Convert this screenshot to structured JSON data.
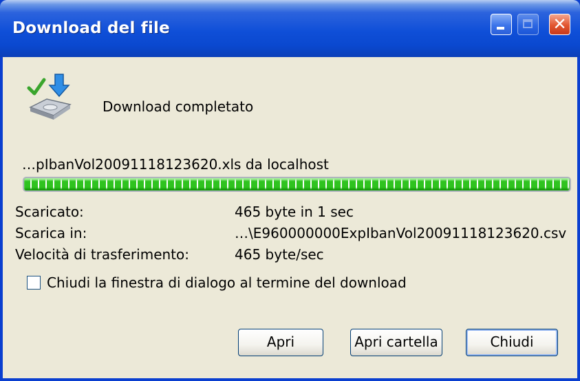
{
  "window": {
    "title": "Download del file"
  },
  "titlebar_buttons": {
    "minimize_icon": "minimize-icon",
    "maximize_icon": "maximize-icon",
    "close_icon": "close-icon",
    "close_glyph": "✕"
  },
  "status": {
    "icon": "download-complete-icon",
    "text": "Download completato"
  },
  "file": {
    "line": "…pIbanVol20091118123620.xls da localhost",
    "progress_percent": 100
  },
  "details": [
    {
      "label": "Scaricato:",
      "value": "465 byte in 1 sec"
    },
    {
      "label": "Scarica in:",
      "value": "…\\E960000000ExpIbanVol20091118123620.csv"
    },
    {
      "label": "Velocità di trasferimento:",
      "value": "465 byte/sec"
    }
  ],
  "checkbox": {
    "label": "Chiudi la finestra di dialogo al termine del download",
    "checked": false
  },
  "buttons": {
    "open": "Apri",
    "open_folder": "Apri cartella",
    "close": "Chiudi"
  },
  "colors": {
    "titlebar": "#0a48cf",
    "close_button": "#e2562f",
    "dialog_bg": "#ece9d8",
    "progress": "#2fc31f"
  }
}
